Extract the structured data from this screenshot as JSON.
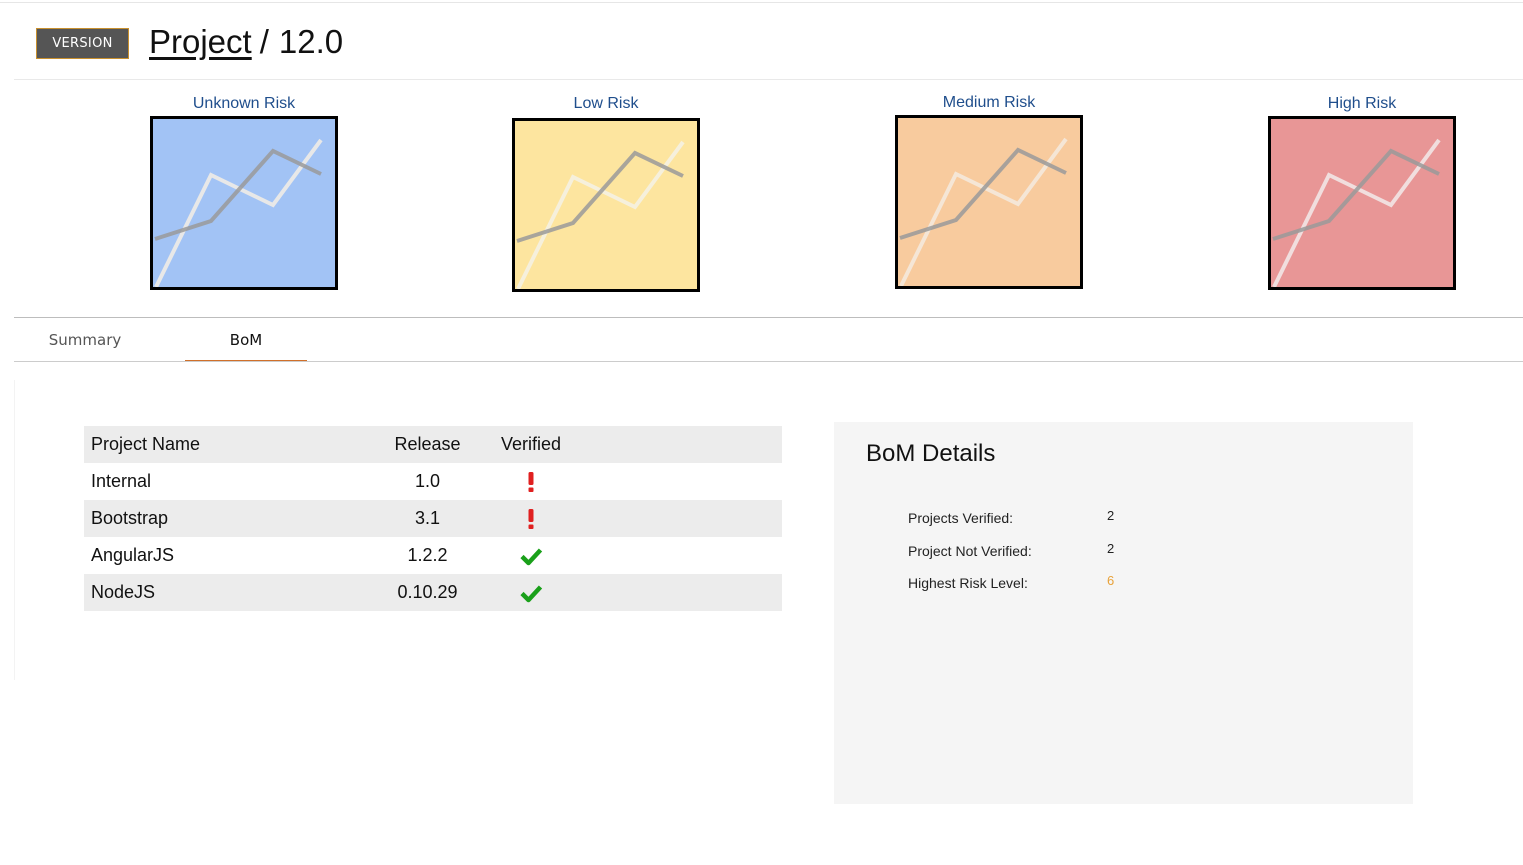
{
  "header": {
    "badge": "VERSION",
    "project_link": "Project",
    "separator": "/",
    "version": "12.0"
  },
  "risk_cards": [
    {
      "label": "Unknown Risk",
      "color": "#a2c3f5"
    },
    {
      "label": "Low Risk",
      "color": "#fde59f"
    },
    {
      "label": "Medium Risk",
      "color": "#f8cb9e"
    },
    {
      "label": "High Risk",
      "color": "#e89696"
    }
  ],
  "tabs": {
    "summary": "Summary",
    "bom": "BoM",
    "active": "bom"
  },
  "bom_table": {
    "headers": {
      "name": "Project Name",
      "release": "Release",
      "verified": "Verified"
    },
    "rows": [
      {
        "name": "Internal",
        "release": "1.0",
        "verified": false
      },
      {
        "name": "Bootstrap",
        "release": "3.1",
        "verified": false
      },
      {
        "name": "AngularJS",
        "release": "1.2.2",
        "verified": true
      },
      {
        "name": "NodeJS",
        "release": "0.10.29",
        "verified": true
      }
    ]
  },
  "bom_details": {
    "title": "BoM Details",
    "projects_verified_label": "Projects Verified:",
    "projects_verified_value": "2",
    "project_not_verified_label": "Project Not Verified:",
    "project_not_verified_value": "2",
    "highest_risk_label": "Highest Risk Level:",
    "highest_risk_value": "6",
    "highest_risk_color": "#e8a23a"
  },
  "colors": {
    "tab_accent": "#d0702a",
    "verified_icon": "#1aa01a",
    "unverified_icon": "#e02020",
    "badge_background": "#555555"
  }
}
